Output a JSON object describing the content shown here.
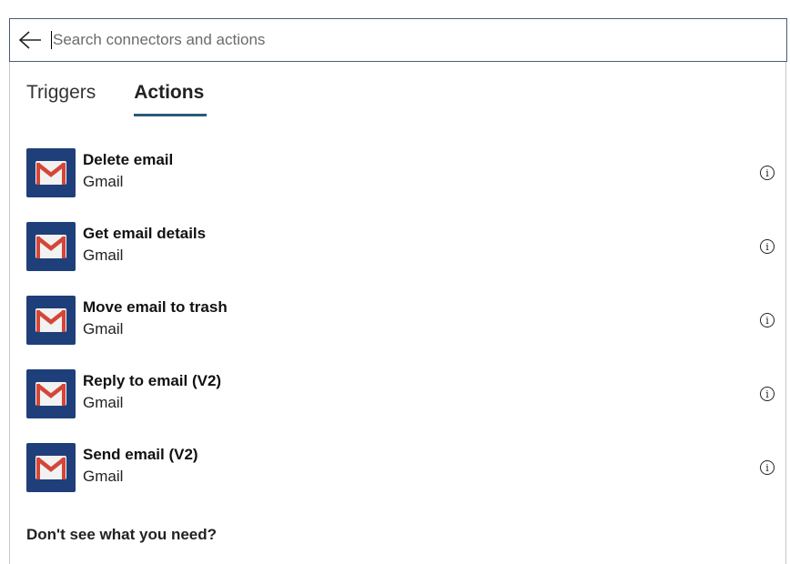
{
  "search": {
    "placeholder": "Search connectors and actions"
  },
  "tabs": [
    {
      "label": "Triggers",
      "active": false
    },
    {
      "label": "Actions",
      "active": true
    }
  ],
  "actions": [
    {
      "title": "Delete email",
      "connector": "Gmail",
      "icon": "gmail-icon"
    },
    {
      "title": "Get email details",
      "connector": "Gmail",
      "icon": "gmail-icon"
    },
    {
      "title": "Move email to trash",
      "connector": "Gmail",
      "icon": "gmail-icon"
    },
    {
      "title": "Reply to email (V2)",
      "connector": "Gmail",
      "icon": "gmail-icon"
    },
    {
      "title": "Send email (V2)",
      "connector": "Gmail",
      "icon": "gmail-icon"
    }
  ],
  "info_glyph": "i",
  "footer": {
    "prompt": "Don't see what you need?"
  },
  "colors": {
    "tile_bg": "#1f3f7a",
    "gmail_red": "#d44638",
    "tab_underline": "#2b5a7a"
  }
}
